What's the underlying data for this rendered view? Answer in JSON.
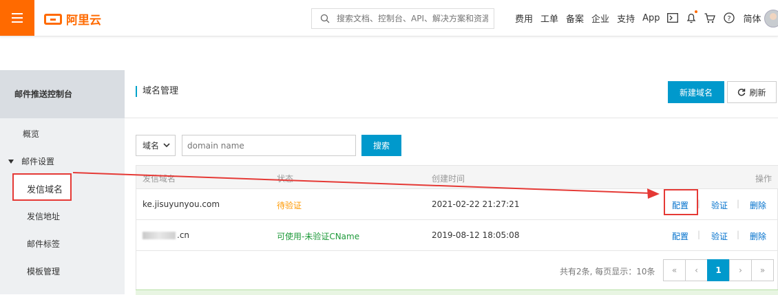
{
  "topbar": {
    "brand": "阿里云",
    "search_placeholder": "搜索文档、控制台、API、解决方案和资源",
    "nav": [
      "费用",
      "工单",
      "备案",
      "企业",
      "支持",
      "App"
    ],
    "lang": "简体",
    "icons": [
      "menu-icon",
      "search-icon",
      "terminal-icon",
      "bell-icon",
      "cart-icon",
      "help-icon"
    ]
  },
  "sidebar": {
    "title": "邮件推送控制台",
    "overview": "概览",
    "group": "邮件设置",
    "items": [
      "发信域名",
      "发信地址",
      "邮件标签",
      "模板管理"
    ]
  },
  "main": {
    "title": "域名管理",
    "new_button": "新建域名",
    "refresh_button": "刷新",
    "filter_select": "域名",
    "input_placeholder": "domain name",
    "search_button": "搜索"
  },
  "table": {
    "headers": [
      "发信域名",
      "状态",
      "创建时间",
      "操作"
    ],
    "rows": [
      {
        "domain": "ke.jisuyunyou.com",
        "status": "待验证",
        "created": "2021-02-22 21:27:21",
        "actions": [
          "配置",
          "验证",
          "删除"
        ]
      },
      {
        "domain": ".cn",
        "status": "可使用-未验证CName",
        "created": "2019-08-12 18:05:08",
        "actions": [
          "配置",
          "验证",
          "删除"
        ]
      }
    ]
  },
  "pagination": {
    "info": "共有2条, 每页显示：10条",
    "first": "«",
    "prev": "‹",
    "current": "1",
    "next": "›",
    "last": "»"
  },
  "colors": {
    "brand": "#ff6a00",
    "primary": "#0099cc",
    "annotation": "#e53935",
    "pending": "#ff9900",
    "ok": "#1e9a3a"
  }
}
